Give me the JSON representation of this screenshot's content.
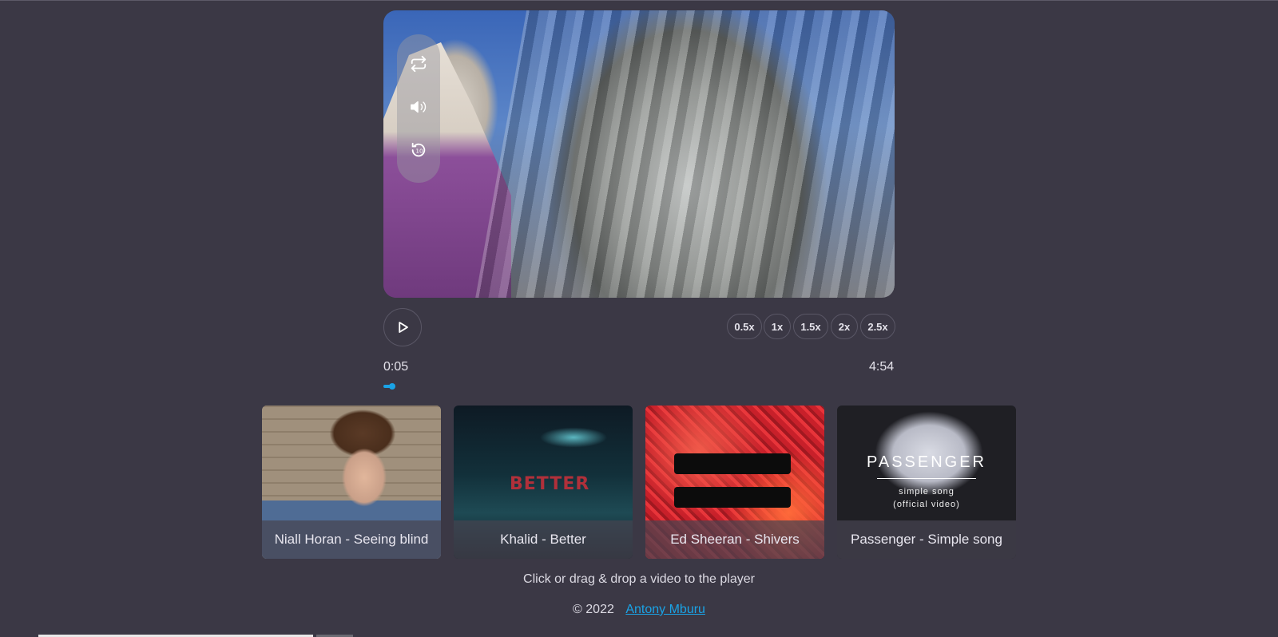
{
  "player": {
    "current_time": "0:05",
    "duration": "4:54",
    "progress_fraction": 0.017,
    "side_controls": [
      {
        "name": "repeat-icon"
      },
      {
        "name": "volume-icon"
      },
      {
        "name": "rewind-10-icon"
      }
    ],
    "play_icon": "play-icon",
    "speeds": [
      "0.5x",
      "1x",
      "1.5x",
      "2x",
      "2.5x"
    ]
  },
  "playlist": [
    {
      "caption": "Niall Horan - Seeing blind",
      "thumb": "niall"
    },
    {
      "caption": "Khalid - Better",
      "thumb": "khalid",
      "overlay_text": "BETTER"
    },
    {
      "caption": "Ed Sheeran - Shivers",
      "thumb": "ed"
    },
    {
      "caption": "Passenger - Simple song",
      "thumb": "passenger",
      "overlay_title": "PASSENGER",
      "overlay_sub1": "simple song",
      "overlay_sub2": "(official video)"
    }
  ],
  "hint": "Click or drag & drop a video to the player",
  "footer": {
    "copyright": "©  2022",
    "author": "Antony Mburu"
  },
  "colors": {
    "background": "#3b3845",
    "accent": "#1aa3e6"
  }
}
